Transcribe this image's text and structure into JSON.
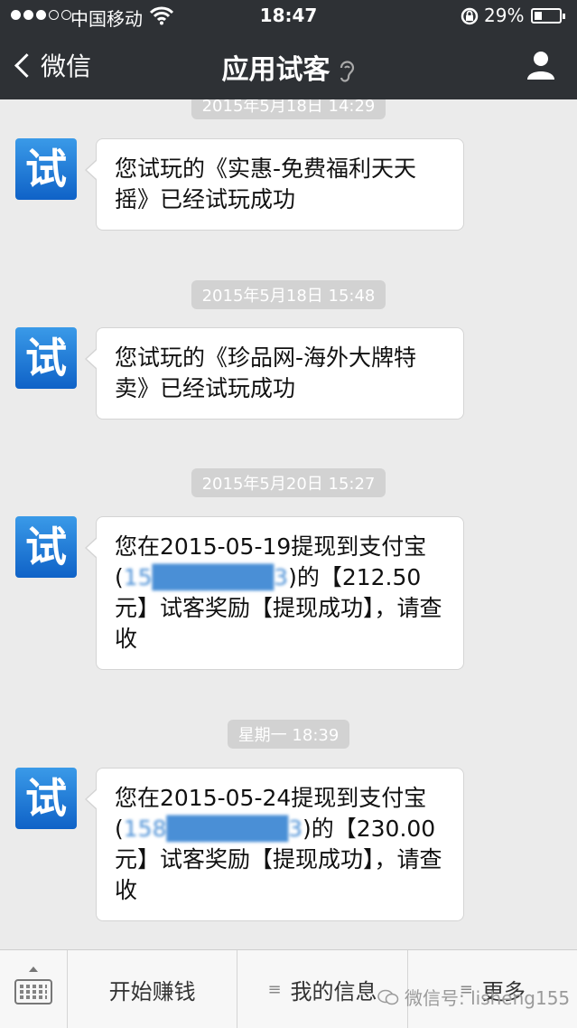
{
  "status_bar": {
    "carrier": "中国移动",
    "time": "18:47",
    "battery_percent": "29%",
    "battery_level": 0.29,
    "signal_bars_filled": 3,
    "signal_bars_total": 5
  },
  "nav": {
    "back_label": "微信",
    "title": "应用试客"
  },
  "avatar_text": "试",
  "messages": [
    {
      "timestamp": "2015年5月18日 14:29",
      "text": "您试玩的《实惠-免费福利天天摇》已经试玩成功"
    },
    {
      "timestamp": "2015年5月18日 15:48",
      "text": "您试玩的《珍品网-海外大牌特卖》已经试玩成功"
    },
    {
      "timestamp": "2015年5月20日 15:27",
      "text_before": "您在2015-05-19提现到支付宝(",
      "masked": "15███████3",
      "text_after": ")的【212.50元】试客奖励【提现成功】，请查收"
    },
    {
      "timestamp": "星期一 18:39",
      "text_before": "您在2015-05-24提现到支付宝(",
      "masked": "158███████3",
      "text_after": ")的【230.00元】试客奖励【提现成功】，请查收"
    }
  ],
  "menu": {
    "item1": "开始赚钱",
    "item2": "我的信息",
    "item3": "更多"
  },
  "watermark": "微信号: lisheng155",
  "colors": {
    "nav_bg": "#2e3135",
    "chat_bg": "#ebebeb",
    "avatar_blue": "#1a73d6",
    "stamp_bg": "#d2d2d2"
  }
}
